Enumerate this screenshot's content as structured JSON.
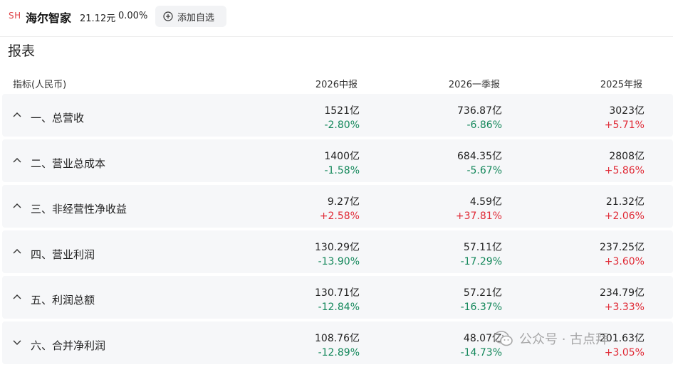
{
  "header": {
    "market": "SH",
    "name": "海尔智家",
    "price": "21.12元",
    "change": "0.00%",
    "add_label": "添加自选"
  },
  "section_title": "报表",
  "table": {
    "columns": [
      "指标(人民币)",
      "2026中报",
      "2026一季报",
      "2025年报"
    ],
    "rows": [
      {
        "label": "一、总营收",
        "expanded": true,
        "cells": [
          {
            "value": "1521亿",
            "pct": "-2.80%",
            "dir": "down"
          },
          {
            "value": "736.87亿",
            "pct": "-6.86%",
            "dir": "down"
          },
          {
            "value": "3023亿",
            "pct": "+5.71%",
            "dir": "up"
          }
        ]
      },
      {
        "label": "二、营业总成本",
        "expanded": true,
        "cells": [
          {
            "value": "1400亿",
            "pct": "-1.58%",
            "dir": "down"
          },
          {
            "value": "684.35亿",
            "pct": "-5.67%",
            "dir": "down"
          },
          {
            "value": "2808亿",
            "pct": "+5.86%",
            "dir": "up"
          }
        ]
      },
      {
        "label": "三、非经营性净收益",
        "expanded": true,
        "cells": [
          {
            "value": "9.27亿",
            "pct": "+2.58%",
            "dir": "up"
          },
          {
            "value": "4.59亿",
            "pct": "+37.81%",
            "dir": "up"
          },
          {
            "value": "21.32亿",
            "pct": "+2.06%",
            "dir": "up"
          }
        ]
      },
      {
        "label": "四、营业利润",
        "expanded": true,
        "cells": [
          {
            "value": "130.29亿",
            "pct": "-13.90%",
            "dir": "down"
          },
          {
            "value": "57.11亿",
            "pct": "-17.29%",
            "dir": "down"
          },
          {
            "value": "237.25亿",
            "pct": "+3.60%",
            "dir": "up"
          }
        ]
      },
      {
        "label": "五、利润总额",
        "expanded": true,
        "cells": [
          {
            "value": "130.71亿",
            "pct": "-12.84%",
            "dir": "down"
          },
          {
            "value": "57.21亿",
            "pct": "-16.37%",
            "dir": "down"
          },
          {
            "value": "234.79亿",
            "pct": "+3.33%",
            "dir": "up"
          }
        ]
      },
      {
        "label": "六、合并净利润",
        "expanded": false,
        "cells": [
          {
            "value": "108.76亿",
            "pct": "-12.89%",
            "dir": "down"
          },
          {
            "value": "48.07亿",
            "pct": "-14.73%",
            "dir": "down"
          },
          {
            "value": "201.63亿",
            "pct": "+3.05%",
            "dir": "up"
          }
        ]
      }
    ]
  },
  "watermark": {
    "text": "公众号 · 古点拜"
  },
  "colors": {
    "up": "#e02a36",
    "down": "#13875a",
    "badge": "#e0474b"
  }
}
